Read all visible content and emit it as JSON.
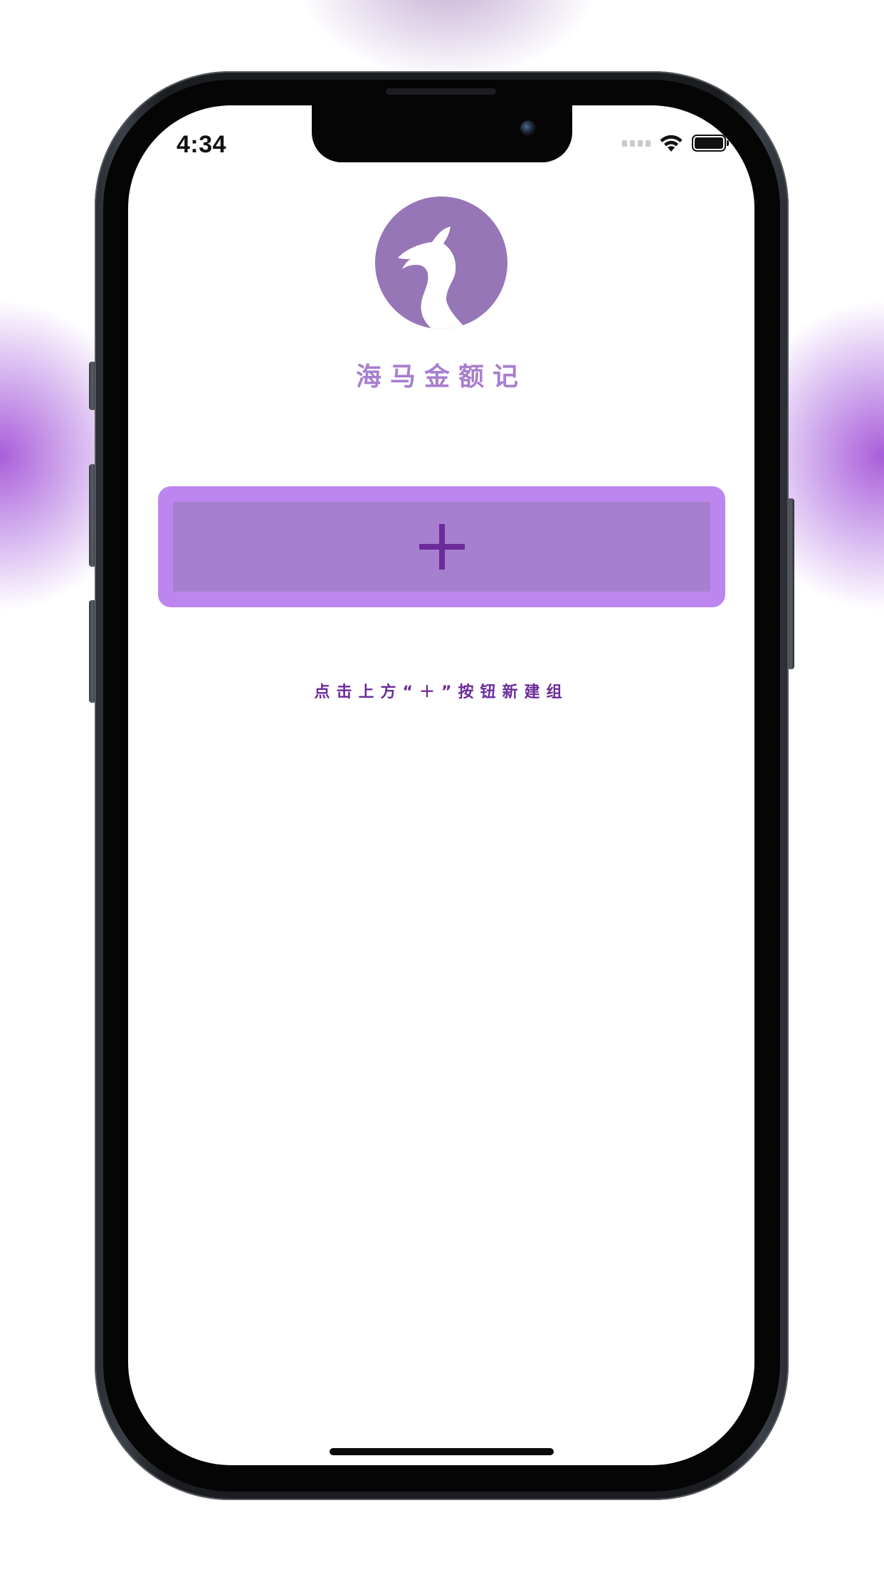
{
  "status_bar": {
    "time": "4:34",
    "icons": [
      "cellular-signal-icon",
      "wifi-icon",
      "battery-icon"
    ]
  },
  "app": {
    "title": "海马金额记",
    "logo_icon": "seahorse-logo-icon",
    "add_button_icon": "plus-icon",
    "hint_text": "点击上方“＋”按钮新建组"
  },
  "colors": {
    "logo_circle": "#9676b6",
    "title_text": "#a77fcf",
    "button_border": "#bd86ef",
    "button_fill": "#a77fcf",
    "plus_icon": "#6b2b9a",
    "hint_text": "#6b2b9a",
    "background_glow": "#a855d7"
  }
}
